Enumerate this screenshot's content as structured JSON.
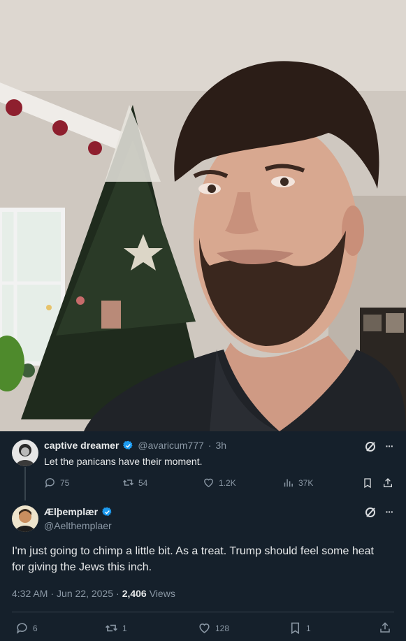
{
  "photo": {
    "description_icon": "selfie-photo"
  },
  "reply_tweet": {
    "display_name": "captive dreamer",
    "handle": "@avaricum777",
    "separator": "·",
    "time_ago": "3h",
    "text": "Let the panicans have their moment.",
    "replies": "75",
    "reposts": "54",
    "likes": "1.2K",
    "views": "37K",
    "more": "···"
  },
  "main_tweet": {
    "display_name": "Ælþemplær",
    "handle": "@Aelthemplaer",
    "text": "I'm just going to chimp a little bit. As a treat. Trump should feel some heat for giving the Jews this inch.",
    "time": "4:32 AM",
    "dot1": "·",
    "date": "Jun 22, 2025",
    "dot2": "·",
    "views_count": "2,406",
    "views_label": "Views",
    "replies": "6",
    "reposts": "1",
    "likes": "128",
    "bookmarks": "1",
    "more": "···"
  },
  "colors": {
    "background": "#15202b",
    "verified": "#1d9bf0",
    "muted": "#8b98a5"
  }
}
